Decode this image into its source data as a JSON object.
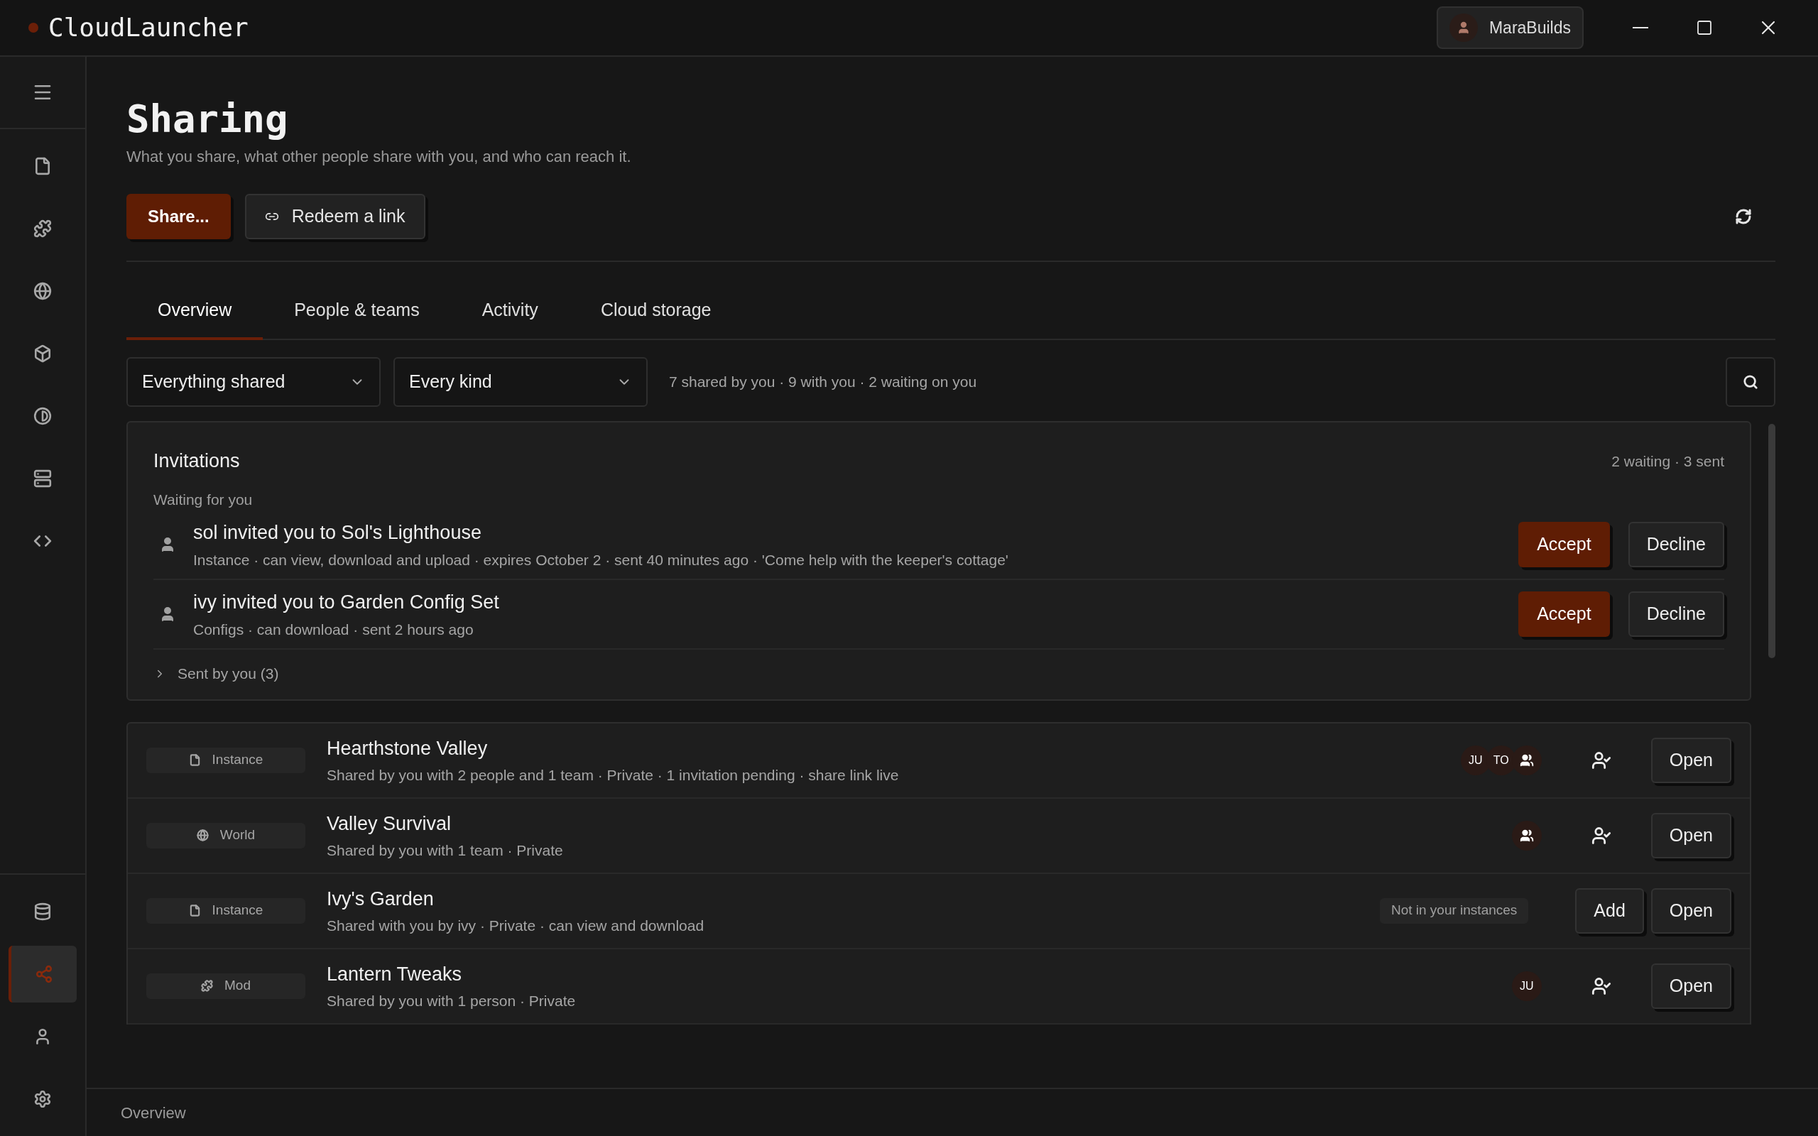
{
  "app": {
    "name": "CloudLauncher",
    "account": "MaraBuilds"
  },
  "sidebar": {
    "items": [
      {
        "kind": "file",
        "selected": false
      },
      {
        "kind": "puzzle",
        "selected": false
      },
      {
        "kind": "globe",
        "selected": false
      },
      {
        "kind": "box",
        "selected": false
      },
      {
        "kind": "contrast",
        "selected": false
      },
      {
        "kind": "server",
        "selected": false
      },
      {
        "kind": "code",
        "selected": false
      }
    ],
    "bottom_items": [
      {
        "kind": "database",
        "selected": false
      },
      {
        "kind": "share",
        "selected": true
      },
      {
        "kind": "user",
        "selected": false
      },
      {
        "kind": "settings",
        "selected": false
      }
    ]
  },
  "page": {
    "title": "Sharing",
    "subtitle": "What you share, what other people share with you, and who can reach it.",
    "primary_button": "Share...",
    "secondary_button": "Redeem a link"
  },
  "tabs": [
    {
      "label": "Overview",
      "selected": true
    },
    {
      "label": "People & teams",
      "selected": false
    },
    {
      "label": "Activity",
      "selected": false
    },
    {
      "label": "Cloud storage",
      "selected": false
    }
  ],
  "filters": [
    {
      "value": "Everything shared"
    },
    {
      "value": "Every kind"
    }
  ],
  "summary": "7 shared by you · 9 with you · 2 waiting on you",
  "invitations": {
    "title": "Invitations",
    "count": "2 waiting · 3 sent",
    "section": "Waiting for you",
    "items": [
      {
        "title": "sol invited you to Sol's Lighthouse",
        "details": "Instance · can view, download and upload · expires October 2 · sent 40 minutes ago · 'Come help with the keeper's cottage'",
        "accept": "Accept",
        "decline": "Decline"
      },
      {
        "title": "ivy invited you to Garden Config Set",
        "details": "Configs · can download · sent 2 hours ago",
        "accept": "Accept",
        "decline": "Decline"
      }
    ],
    "sent": {
      "label": "Sent by you (3)",
      "expanded": false
    }
  },
  "shares": [
    {
      "kind": "instance",
      "type": "Instance",
      "name": "Hearthstone Valley",
      "details": "Shared by you with 2 people and 1 team · Private · 1 invitation pending · share link live",
      "avatars": [
        {
          "kind": "person",
          "initials": "JU"
        },
        {
          "kind": "person",
          "initials": "TO"
        },
        {
          "kind": "team"
        }
      ],
      "access_icon": true,
      "actions": [
        "Open"
      ]
    },
    {
      "kind": "world",
      "type": "World",
      "name": "Valley Survival",
      "details": "Shared by you with 1 team · Private",
      "avatars": [
        {
          "kind": "team"
        }
      ],
      "access_icon": true,
      "actions": [
        "Open"
      ]
    },
    {
      "kind": "instance",
      "type": "Instance",
      "name": "Ivy's Garden",
      "details": "Shared with you by ivy · Private · can view and download",
      "badge": "Not in your instances",
      "access_icon": false,
      "actions": [
        "Add",
        "Open"
      ]
    },
    {
      "kind": "mod",
      "type": "Mod",
      "name": "Lantern Tweaks",
      "details": "Shared by you with 1 person · Private",
      "avatars": [
        {
          "kind": "person",
          "initials": "JU"
        }
      ],
      "access_icon": true,
      "actions": [
        "Open"
      ]
    }
  ],
  "status_bar": "Overview"
}
